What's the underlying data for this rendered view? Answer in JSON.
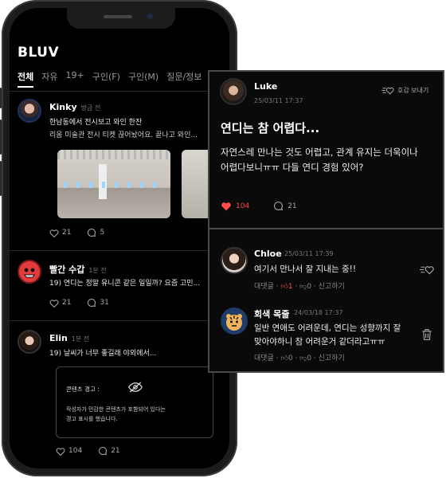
{
  "app": {
    "logo": "BLUV"
  },
  "tabs": [
    "전체",
    "자유",
    "19+",
    "구인(F)",
    "구인(M)",
    "질문/정보"
  ],
  "feed": [
    {
      "user": "Kinky",
      "time": "방금 전",
      "line1": "한남동에서 전시보고 와인 한잔",
      "line2": "리움 미술관 전시 티켓 끊어놨어요. 끝나고 와인...",
      "likes": "21",
      "comments": "5"
    },
    {
      "user": "빨간 수갑",
      "time": "1분 전",
      "line1": "19) 연디는 정말 유니콘 같은 일일까? 요즘 고민...",
      "likes": "21",
      "comments": "31"
    },
    {
      "user": "Elin",
      "time": "1분 전",
      "line1": "19) 날씨가 너무 좋길래 야외에서...",
      "warning_title": "콘텐츠 경고 :",
      "warning_body_1": "작성자가 민감한 콘텐츠가 포함되어 있다는",
      "warning_body_2": "경고 표시를 했습니다.",
      "likes": "104",
      "comments": "21"
    }
  ],
  "detail": {
    "user": "Luke",
    "time": "25/03/11 17:37",
    "send_like": "호감 보내기",
    "title": "연디는 참 어렵다...",
    "body_1": "자연스레 만나는 것도 어렵고, 관계 유지는 더욱이나",
    "body_2": "어렵다보니ㅠㅠ 다들 연디 경험 있어?",
    "likes": "104",
    "comments": "21"
  },
  "comments": [
    {
      "user": "Chloe",
      "time": "25/03/11 17:39",
      "text": "여기서 만나서 잘 지내는 중!!",
      "reply": "대댓글",
      "likes": "1",
      "dislikes": "0",
      "report": "신고하기"
    },
    {
      "user": "회색 목줄",
      "time": "24/03/18 17:37",
      "text_1": "일반 연애도 어려운데, 연디는 성향까지 잘",
      "text_2": "맞아야하니 참 어려운거 같더라고ㅠㅠ",
      "reply": "대댓글",
      "likes": "0",
      "dislikes": "0",
      "report": "신고하기"
    }
  ],
  "colors": {
    "accent_red": "#ff4b4b",
    "background": "#000000"
  }
}
